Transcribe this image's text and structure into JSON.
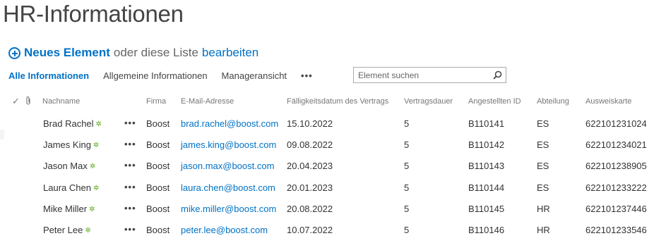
{
  "page": {
    "title": "HR-Informationen"
  },
  "new_item": {
    "label": "Neues Element",
    "middle": "oder diese Liste",
    "edit": "bearbeiten"
  },
  "views": {
    "items": [
      "Alle Informationen",
      "Allgemeine Informationen",
      "Manageransicht"
    ],
    "more": "•••"
  },
  "search": {
    "placeholder": "Element suchen"
  },
  "columns": {
    "check": "✓",
    "name": "Nachname",
    "company": "Firma",
    "email": "E-Mail-Adresse",
    "due": "Fälligkeitsdatum des Vertrags",
    "duration": "Vertragsdauer",
    "empid": "Angestellten ID",
    "dept": "Abteilung",
    "badge": "Ausweiskarte"
  },
  "row_more": "•••",
  "new_marker": "✲",
  "rows": [
    {
      "name": "Brad Rachel",
      "company": "Boost",
      "email": "brad.rachel@boost.com",
      "due": "15.10.2022",
      "duration": "5",
      "empid": "B110141",
      "dept": "ES",
      "badge": "622101231024"
    },
    {
      "name": "James King",
      "company": "Boost",
      "email": "james.king@boost.com",
      "due": "09.08.2022",
      "duration": "5",
      "empid": "B110142",
      "dept": "ES",
      "badge": "622101234021"
    },
    {
      "name": "Jason Max",
      "company": "Boost",
      "email": "jason.max@boost.com",
      "due": "20.04.2023",
      "duration": "5",
      "empid": "B110143",
      "dept": "ES",
      "badge": "622101238905"
    },
    {
      "name": "Laura Chen",
      "company": "Boost",
      "email": "laura.chen@boost.com",
      "due": "20.01.2023",
      "duration": "5",
      "empid": "B110144",
      "dept": "ES",
      "badge": "622101233222"
    },
    {
      "name": "Mike Miller",
      "company": "Boost",
      "email": "mike.miller@boost.com",
      "due": "20.08.2022",
      "duration": "5",
      "empid": "B110145",
      "dept": "HR",
      "badge": "622101237446"
    },
    {
      "name": "Peter Lee",
      "company": "Boost",
      "email": "peter.lee@boost.com",
      "due": "10.07.2022",
      "duration": "5",
      "empid": "B110146",
      "dept": "HR",
      "badge": "622101233546"
    }
  ],
  "colors": {
    "accent": "#0072c6",
    "new_marker": "#5ca81e",
    "text": "#333333",
    "muted": "#777777"
  }
}
